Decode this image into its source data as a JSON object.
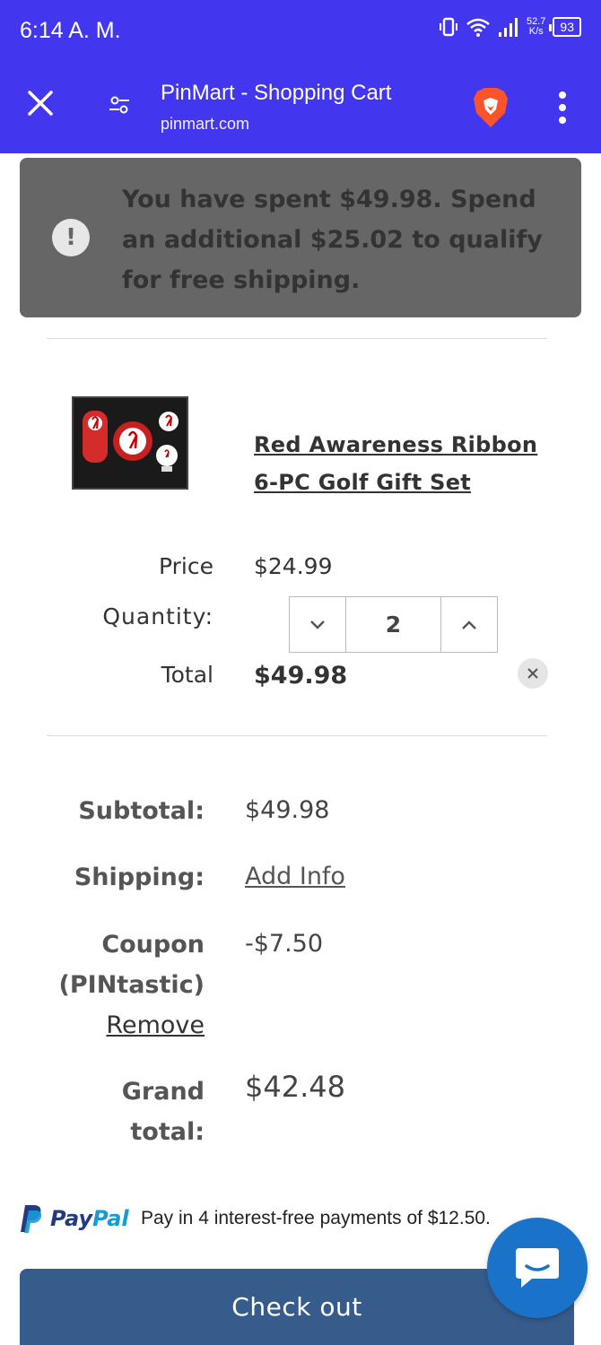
{
  "status_bar": {
    "time": "6:14 A. M.",
    "speed_value": "52.7",
    "speed_unit": "K/s",
    "battery": "93"
  },
  "browser": {
    "page_title": "PinMart - Shopping Cart",
    "host": "pinmart.com"
  },
  "banner": {
    "message": "You have spent $49.98. Spend an additional $25.02 to qualify for free shipping.",
    "icon_symbol": "!"
  },
  "product": {
    "name": "Red Awareness Ribbon 6-PC Golf Gift Set",
    "price_label": "Price",
    "price": "$24.99",
    "quantity_label": "Quantity:",
    "quantity": "2",
    "total_label": "Total",
    "total": "$49.98"
  },
  "summary": {
    "subtotal_label": "Subtotal:",
    "subtotal": "$49.98",
    "shipping_label": "Shipping:",
    "shipping_link": "Add Info",
    "coupon_label": "Coupon",
    "coupon_code": "(PINtastic)",
    "coupon_remove": "Remove",
    "coupon_value": "-$7.50",
    "grand_total_label_1": "Grand",
    "grand_total_label_2": "total:",
    "grand_total": "$42.48"
  },
  "paypal": {
    "brand_pay": "Pay",
    "brand_pal": "Pal",
    "message": "Pay in 4 interest-free payments of $12.50."
  },
  "checkout": {
    "label": "Check out"
  },
  "colors": {
    "toolbar": "#4336ef",
    "banner": "#666666",
    "checkout": "#365c8c",
    "chat": "#1a73c8"
  }
}
